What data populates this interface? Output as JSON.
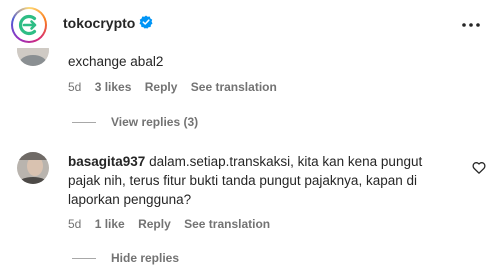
{
  "header": {
    "username": "tokocrypto",
    "icons": {
      "avatar": "tokocrypto-logo",
      "verified": "verified-badge-icon",
      "more": "more-options-icon"
    },
    "brand_color": "#2ebd85",
    "verified_color": "#0095f6"
  },
  "comments": [
    {
      "text": "exchange abal2",
      "meta": {
        "age": "5d",
        "likes": "3 likes",
        "reply": "Reply",
        "translate": "See translation"
      },
      "view_replies": "View replies (3)"
    },
    {
      "username": "basagita937",
      "text": "dalam.setiap.transkaksi, kita kan kena pungut pajak nih, terus fitur bukti tanda pungut pajaknya, kapan di laporkan pengguna?",
      "meta": {
        "age": "5d",
        "likes": "1 like",
        "reply": "Reply",
        "translate": "See translation"
      },
      "hide_replies": "Hide replies",
      "icons": {
        "like": "heart-icon"
      }
    }
  ]
}
